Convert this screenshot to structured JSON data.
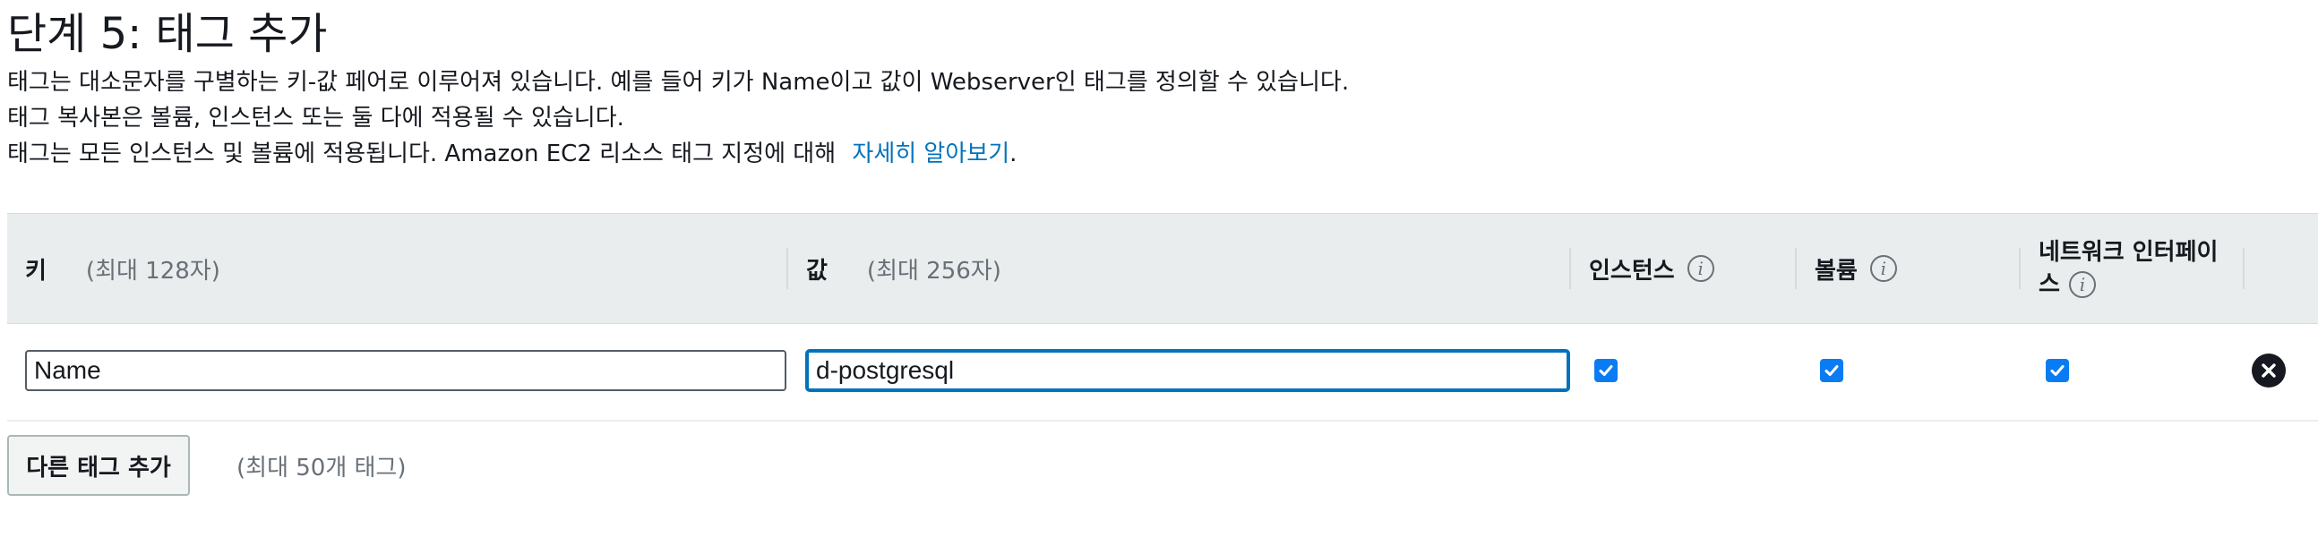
{
  "page_title": "단계 5: 태그 추가",
  "description": {
    "line1": "태그는 대소문자를 구별하는 키-값 페어로 이루어져 있습니다. 예를 들어 키가 Name이고 값이 Webserver인 태그를 정의할 수 있습니다.",
    "line2": "태그 복사본은 볼륨, 인스턴스 또는 둘 다에 적용될 수 있습니다.",
    "line3_text": "태그는 모든 인스턴스 및 볼륨에 적용됩니다. Amazon EC2 리소스 태그 지정에 대해",
    "line3_link": "자세히 알아보기",
    "line3_end": "."
  },
  "table": {
    "headers": {
      "key_label": "키",
      "key_hint": "(최대 128자)",
      "value_label": "값",
      "value_hint": "(최대 256자)",
      "instances_label": "인스턴스",
      "volumes_label": "볼륨",
      "network_label_line1": "네트워크 인터페이",
      "network_label_line2": "스"
    },
    "info_glyph": "i",
    "rows": [
      {
        "key": "Name",
        "value": "d-postgresql",
        "instances_checked": true,
        "volumes_checked": true,
        "network_checked": true
      }
    ]
  },
  "add_tag_button": "다른 태그 추가",
  "add_tag_hint": "(최대 50개 태그)",
  "colors": {
    "link": "#0073bb",
    "checkbox": "#0a7cf3",
    "header_bg": "#eaeded",
    "focus_border": "#0073bb"
  },
  "icons": {
    "info": "info-icon",
    "checkbox": "checkmark-icon",
    "remove": "close-circle-icon"
  }
}
